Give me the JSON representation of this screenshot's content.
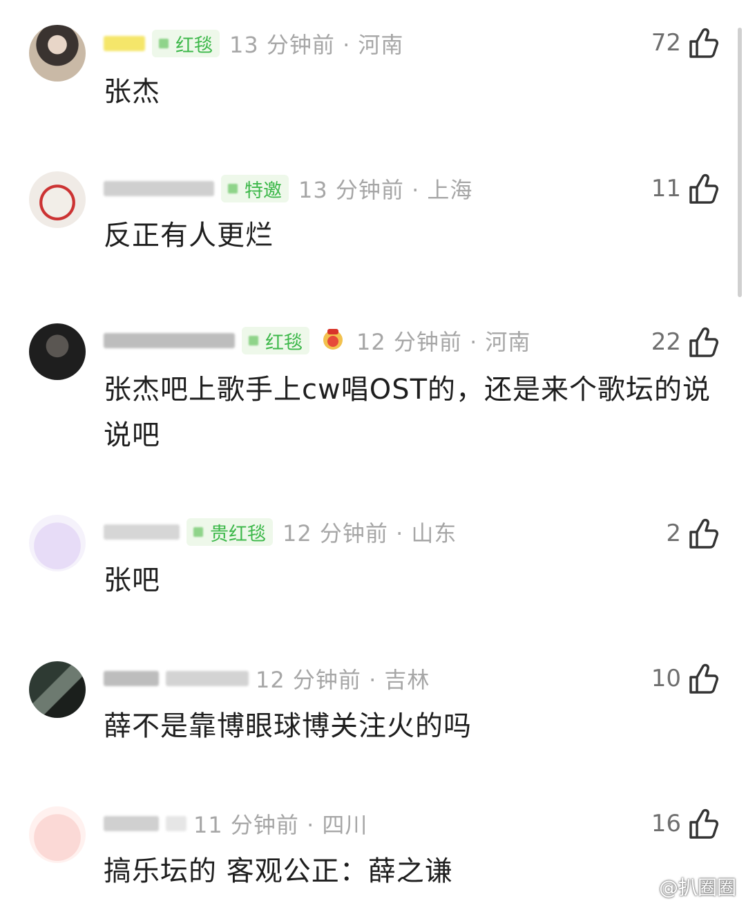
{
  "comments": [
    {
      "location_time": "13 分钟前 · 河南",
      "badge": "红毯",
      "likes": "72",
      "text": "张杰"
    },
    {
      "location_time": "13 分钟前 · 上海",
      "badge": "特邀",
      "likes": "11",
      "text": "反正有人更烂"
    },
    {
      "location_time": "12 分钟前 · 河南",
      "badge": "红毯",
      "likes": "22",
      "text": "张杰吧上歌手上cw唱OST的，还是来个歌坛的说说吧"
    },
    {
      "location_time": "12 分钟前 · 山东",
      "badge": "贵红毯",
      "likes": "2",
      "text": "张吧"
    },
    {
      "location_time": "12 分钟前 · 吉林",
      "badge": "",
      "likes": "10",
      "text": "薛不是靠博眼球博关注火的吗"
    },
    {
      "location_time": "11 分钟前 · 四川",
      "badge": "",
      "likes": "16",
      "text": "搞乐坛的 客观公正：薛之谦"
    }
  ],
  "watermark": {
    "text": "@扒圈圈"
  },
  "colors": {
    "badge_text": "#3db84a",
    "badge_bg": "#eef8ea",
    "meta": "#a6a6a6"
  }
}
